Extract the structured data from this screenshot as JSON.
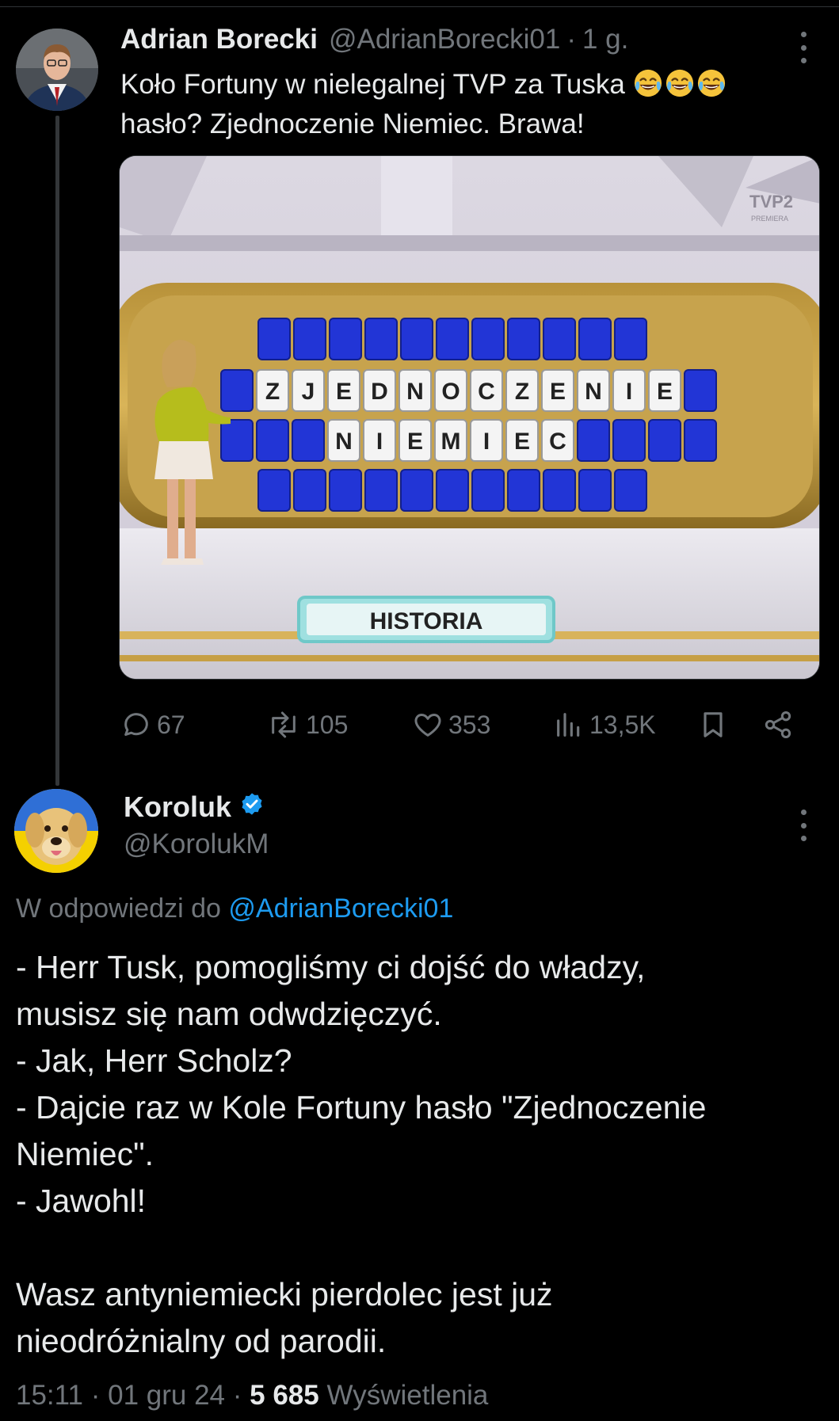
{
  "tweet": {
    "author_name": "Adrian Borecki",
    "author_handle": "@AdrianBorecki01",
    "separator": "·",
    "time": "1 g.",
    "text_line1": "Koło Fortuny w nielegalnej TVP za Tuska",
    "text_line2": "hasło? Zjednoczenie Niemiec. Brawa!",
    "emojis": [
      "face-with-tears-of-joy",
      "face-with-tears-of-joy",
      "face-with-tears-of-joy"
    ],
    "media": {
      "channel_logo": "TVP2",
      "channel_sub": "PREMIERA",
      "board_row1": [
        "Z",
        "J",
        "E",
        "D",
        "N",
        "O",
        "C",
        "Z",
        "E",
        "N",
        "I",
        "E"
      ],
      "board_row2": [
        "N",
        "I",
        "E",
        "M",
        "I",
        "E",
        "C"
      ],
      "category": "HISTORIA"
    },
    "stats": {
      "replies": "67",
      "reposts": "105",
      "likes": "353",
      "views": "13,5K"
    }
  },
  "reply": {
    "author_name": "Koroluk",
    "author_handle": "@KorolukM",
    "verified": true,
    "reply_prefix": "W odpowiedzi do",
    "reply_mention": "@AdrianBorecki01",
    "lines": [
      "- Herr Tusk, pomogliśmy ci dojść do władzy,",
      "musisz się nam odwdzięczyć.",
      "- Jak, Herr Scholz?",
      "- Dajcie raz w Kole Fortuny hasło \"Zjednoczenie",
      "Niemiec\".",
      "- Jawohl!",
      "",
      "Wasz antyniemiecki pierdolec jest już",
      "nieodróżnialny od parodii."
    ],
    "time": "15:11",
    "separator": "·",
    "date": "01 gru 24",
    "views_count": "5 685",
    "views_label": "Wyświetlenia"
  },
  "colors": {
    "background": "#000000",
    "text": "#e7e9ea",
    "secondary": "#71767b",
    "link": "#1d9bf0",
    "thread_line": "#333639"
  }
}
